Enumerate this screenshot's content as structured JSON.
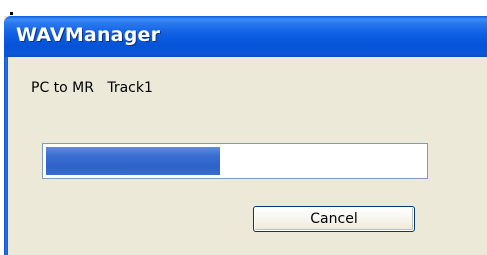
{
  "window": {
    "title": "WAVManager"
  },
  "dialog": {
    "status_text": "PC to MR   Track1",
    "progress": {
      "fraction": 0.46
    },
    "cancel_label": "Cancel"
  },
  "colors": {
    "titlebar": "#0553d6",
    "dialog_background": "#ece9d8",
    "progress_fill": "#3b6fd1",
    "progress_border": "#7f9db9"
  }
}
